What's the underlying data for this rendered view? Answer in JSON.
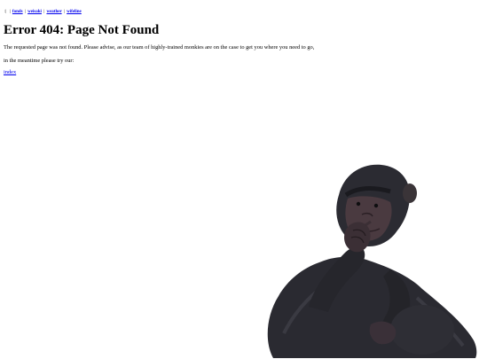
{
  "nav": {
    "prefix": ":|",
    "links": [
      "fonds",
      "weisaki",
      "weather",
      "wifeline"
    ]
  },
  "title": "Error 404: Page Not Found",
  "message": {
    "line1": "The requested page was not found. Please advise, as our team of highly-trained monkies are on the case to get you where you need to go,",
    "line2": "in the meantime please try our:"
  },
  "index_link": "index",
  "colors": {
    "link": "#0000ee",
    "background": "#ffffff",
    "text": "#000000"
  },
  "image": {
    "icon": "chimpanzee-image"
  }
}
